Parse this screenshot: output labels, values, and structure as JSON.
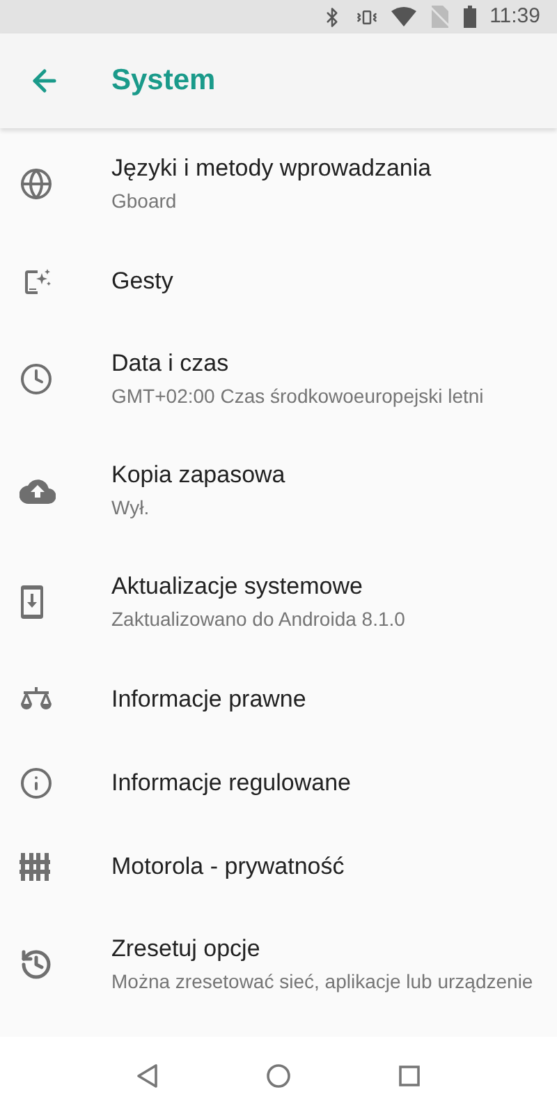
{
  "status_bar": {
    "time": "11:39"
  },
  "app_bar": {
    "title": "System"
  },
  "items": [
    {
      "title": "Języki i metody wprowadzania",
      "subtitle": "Gboard"
    },
    {
      "title": "Gesty"
    },
    {
      "title": "Data i czas",
      "subtitle": "GMT+02:00 Czas środkowoeuropejski letni"
    },
    {
      "title": "Kopia zapasowa",
      "subtitle": "Wył."
    },
    {
      "title": "Aktualizacje systemowe",
      "subtitle": "Zaktualizowano do Androida 8.1.0"
    },
    {
      "title": "Informacje prawne"
    },
    {
      "title": "Informacje regulowane"
    },
    {
      "title": "Motorola - prywatność"
    },
    {
      "title": "Zresetuj opcje",
      "subtitle": "Można zresetować sieć, aplikacje lub urządzenie"
    }
  ]
}
